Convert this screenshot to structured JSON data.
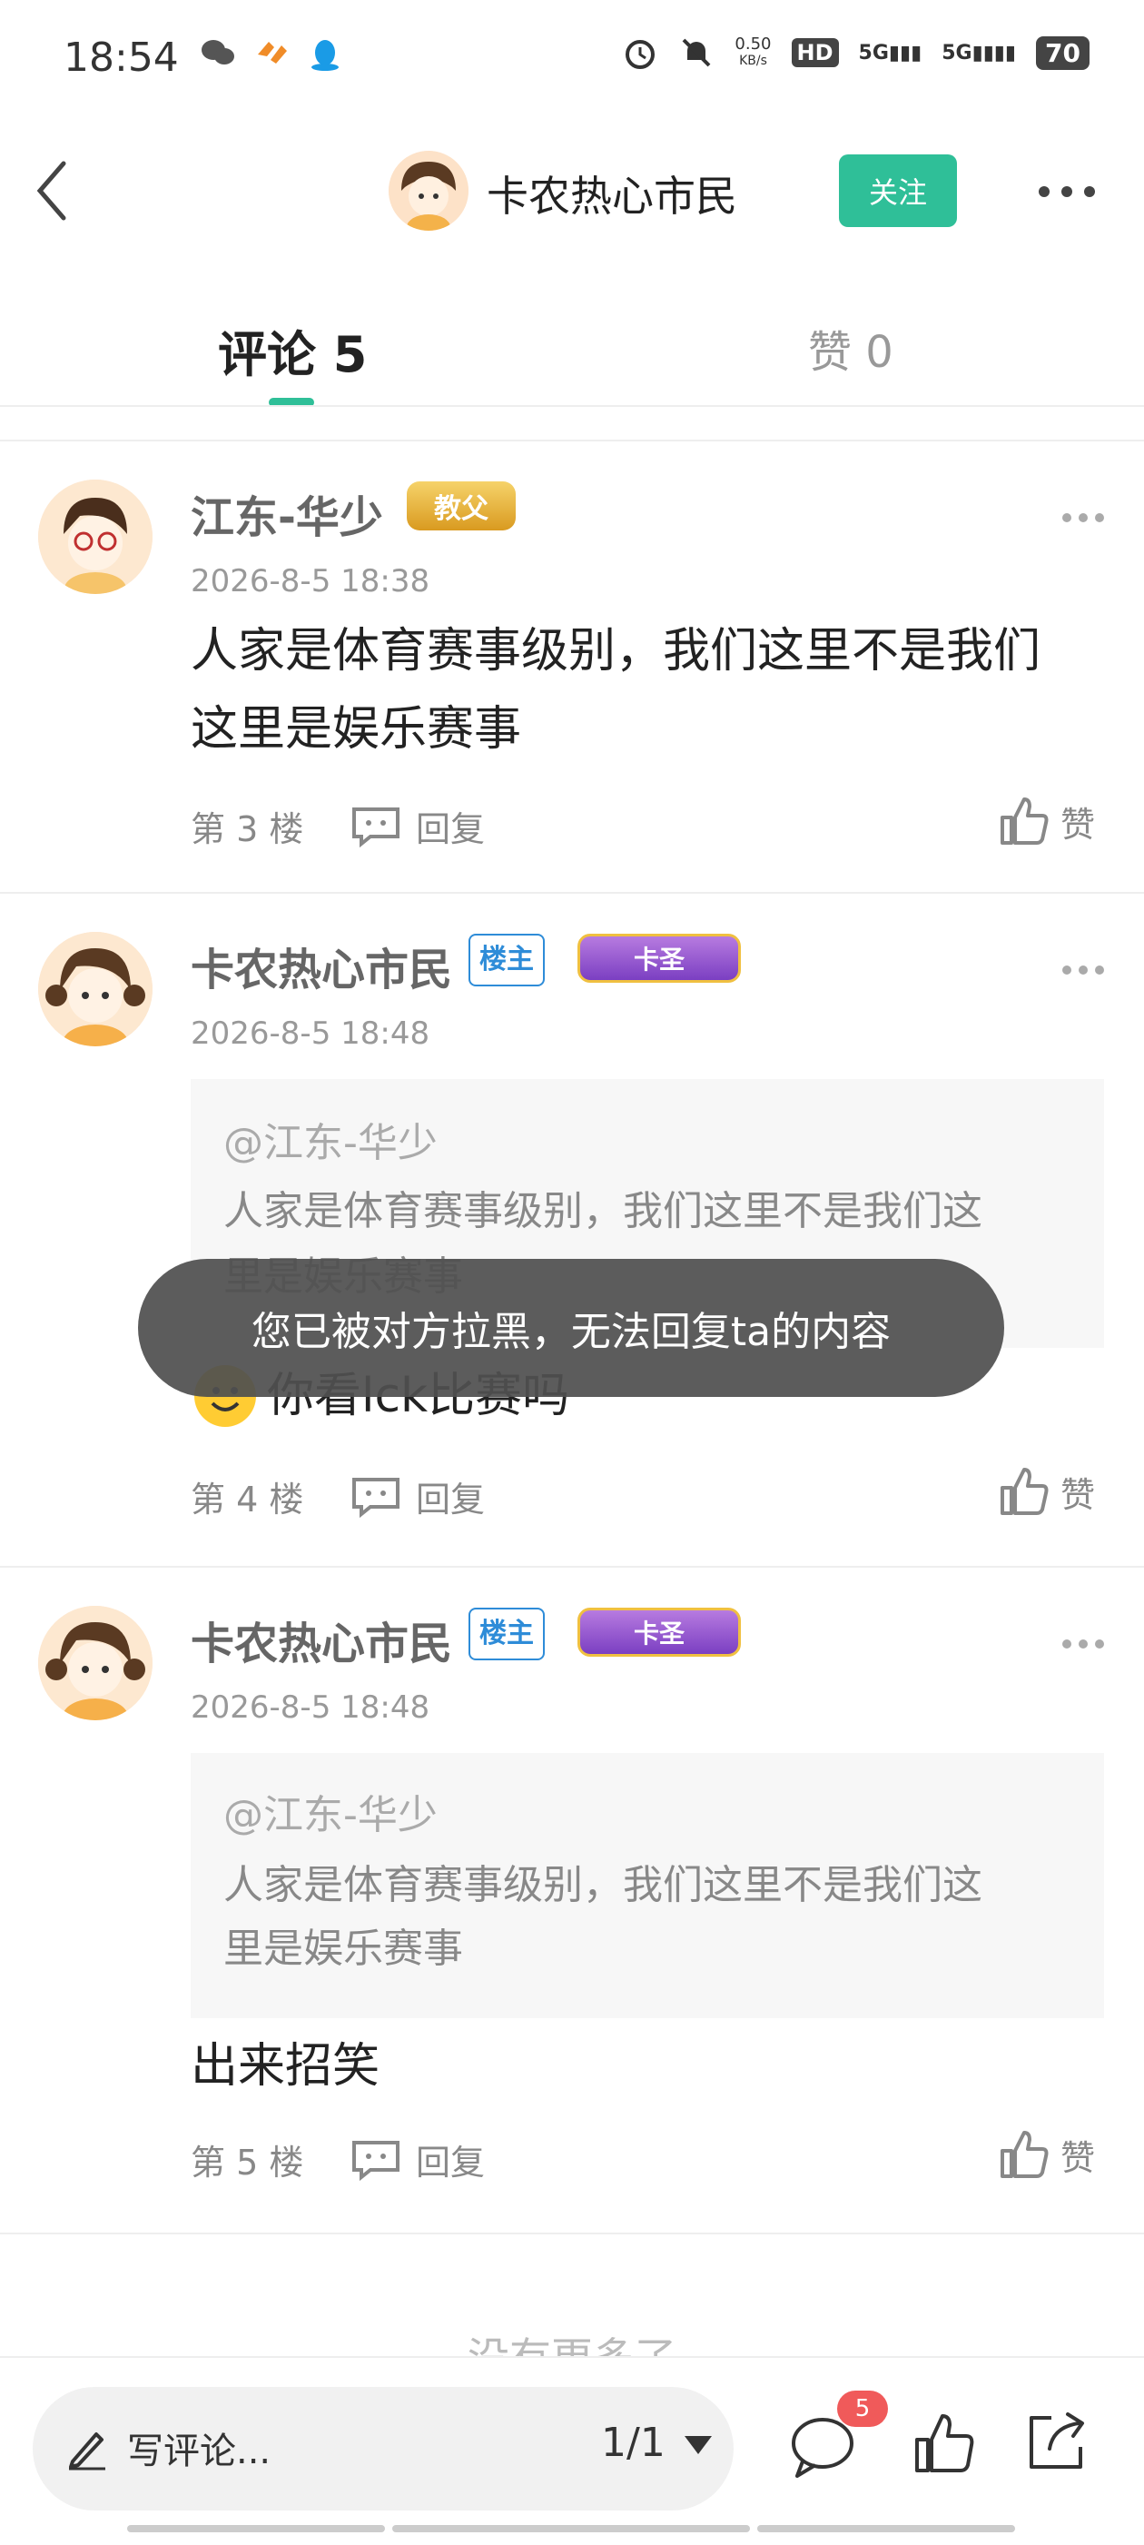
{
  "status_bar": {
    "time": "18:54",
    "net_speed_value": "0.50",
    "net_speed_unit": "KB/s",
    "hd_label": "HD",
    "sim1_label": "5G",
    "sim2_label": "5G",
    "battery": "70"
  },
  "header": {
    "name": "卡农热心市民",
    "follow_label": "关注"
  },
  "tabs": {
    "comments": "评论 5",
    "likes": "赞 0"
  },
  "comments": [
    {
      "username": "江东-华少",
      "title_badge": "教父",
      "timestamp": "2026-8-5 18:38",
      "text_line1": "人家是体育赛事级别，我们这里不是我们",
      "text_line2": "这里是娱乐赛事",
      "floor": "第 3 楼",
      "reply": "回复",
      "like": "赞"
    },
    {
      "username": "卡农热心市民",
      "host_badge": "楼主",
      "title_badge": "卡圣",
      "timestamp": "2026-8-5 18:48",
      "quote_user": "@江东-华少",
      "quote_line1": "人家是体育赛事级别，我们这里不是我们这",
      "quote_line2": "里是娱乐赛事",
      "text": "你看lck比赛吗",
      "floor": "第 4 楼",
      "reply": "回复",
      "like": "赞"
    },
    {
      "username": "卡农热心市民",
      "host_badge": "楼主",
      "title_badge": "卡圣",
      "timestamp": "2026-8-5 18:48",
      "quote_user": "@江东-华少",
      "quote_line1": "人家是体育赛事级别，我们这里不是我们这",
      "quote_line2": "里是娱乐赛事",
      "text": "出来招笑",
      "floor": "第 5 楼",
      "reply": "回复",
      "like": "赞"
    }
  ],
  "toast": "您已被对方拉黑，无法回复ta的内容",
  "no_more": "没有更多了",
  "bottom_bar": {
    "write_placeholder": "写评论...",
    "page": "1/1",
    "comment_count": "5"
  },
  "colors": {
    "accent": "#2fbf98",
    "host_badge": "#2e8cd8",
    "count_badge": "#f05a5a"
  },
  "icons": [
    "wechat-icon",
    "app-icon",
    "qq-icon",
    "alarm-icon",
    "mute-icon",
    "back-icon",
    "more-icon",
    "reply-icon",
    "thumb-up-icon",
    "pen-icon",
    "dropdown-icon",
    "comment-icon",
    "share-icon"
  ]
}
